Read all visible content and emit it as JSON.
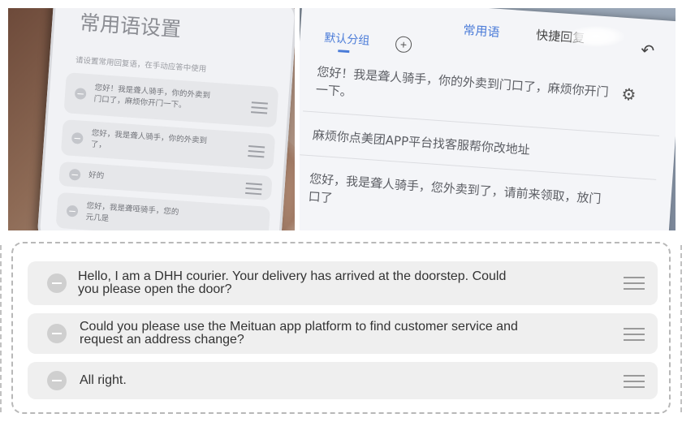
{
  "photo_left": {
    "screen_title": "常用语设置",
    "hint": "请设置常用回复语，在手动应答中使用",
    "phrases": [
      {
        "line1": "您好！我是聋人骑手，你的外卖到",
        "line2": "门口了，麻烦你开门一下。"
      },
      {
        "line1": "您好，我是聋人骑手，你的外卖到",
        "line2": "了，"
      },
      {
        "line1": "好的",
        "line2": ""
      },
      {
        "line1": "您好，我是聋哑骑手，您的",
        "line2": "元几是"
      }
    ]
  },
  "photo_right": {
    "tabs": [
      "常用语",
      "快捷回复"
    ],
    "group_label": "默认分组",
    "phrases": [
      {
        "line1": "您好！我是聋人骑手，你的外卖到门口了，麻烦你开门",
        "line2": "一下。"
      },
      {
        "line1": "麻烦你点美团APP平台找客服帮你改地址",
        "line2": ""
      },
      {
        "line1": "您好，我是聋人骑手，您外卖到了，请前来领取，放门",
        "line2": "口了"
      }
    ]
  },
  "translated_list": {
    "items": [
      {
        "line1": "Hello, I am a DHH courier. Your delivery has arrived at the doorstep. Could",
        "line2": "you please open the door?"
      },
      {
        "line1": "Could you please use the Meituan app platform to find customer service and",
        "line2": "request an address change?"
      },
      {
        "line1": "All right.",
        "line2": ""
      }
    ]
  }
}
